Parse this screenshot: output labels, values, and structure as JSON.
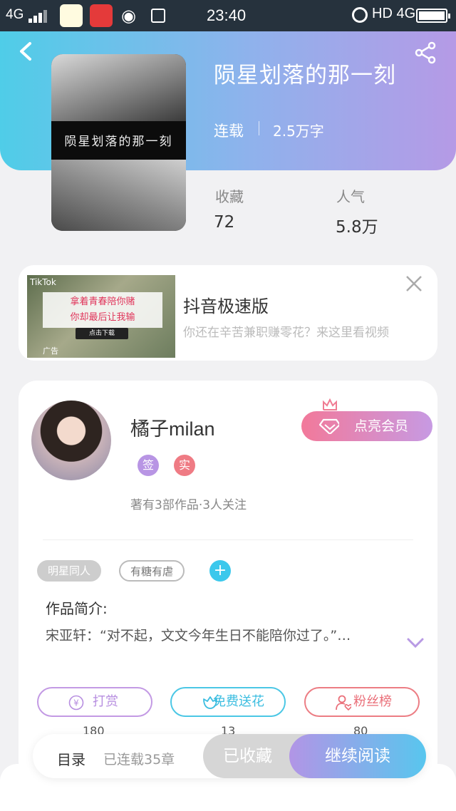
{
  "status_bar": {
    "network": "4G",
    "time": "23:40",
    "right": "HD 4G"
  },
  "header": {
    "back_icon": "back-arrow-icon",
    "share_icon": "share-icon"
  },
  "book": {
    "title": "陨星划落的那一刻",
    "cover_text": "陨星划落的那一刻",
    "status": "连载",
    "word_count": "2.5万字",
    "stats": [
      {
        "label": "收藏",
        "value": "72"
      },
      {
        "label": "人气",
        "value": "5.8万"
      }
    ]
  },
  "ad": {
    "title": "抖音极速版",
    "description": "你还在辛苦兼职赚零花？来这里看视频",
    "banner_line1": "拿着青春陪你赌",
    "banner_line2": "你却最后让我输",
    "banner_button": "点击下载",
    "brand": "TikTok",
    "ad_label": "广告"
  },
  "author": {
    "name": "橘子milan",
    "badges": [
      "签",
      "实"
    ],
    "meta": "著有3部作品·3人关注",
    "vip_button": "点亮会员"
  },
  "tags": [
    "明星同人",
    "有糖有虐"
  ],
  "intro": {
    "heading": "作品简介:",
    "text": "宋亚轩：“对不起，文文今年生日不能陪你过了。”…"
  },
  "actions": [
    {
      "label": "打赏",
      "count": "180"
    },
    {
      "label": "免费送花",
      "count": "13"
    },
    {
      "label": "粉丝榜",
      "count": "80"
    }
  ],
  "bottom_bar": {
    "toc": "目录",
    "chapters": "已连载35章",
    "favorited": "已收藏",
    "continue": "继续阅读"
  },
  "colors": {
    "accent_cyan": "#4fcde8",
    "accent_purple": "#b59ae6",
    "pink": "#f2799a"
  }
}
